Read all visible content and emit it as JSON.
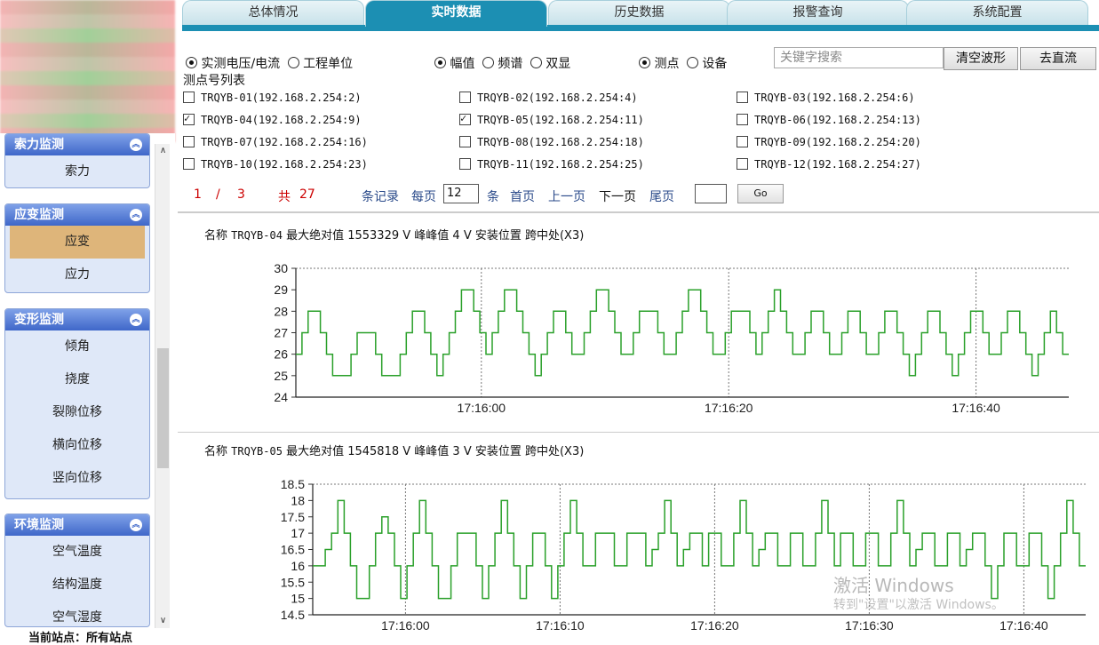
{
  "tabs": [
    "总体情况",
    "实时数据",
    "历史数据",
    "报警查询",
    "系统配置"
  ],
  "active_tab": 1,
  "sidebar": {
    "groups": [
      {
        "title": "索力监测",
        "items": [
          "索力"
        ]
      },
      {
        "title": "应变监测",
        "items": [
          "应变",
          "应力"
        ],
        "active": 0
      },
      {
        "title": "变形监测",
        "items": [
          "倾角",
          "挠度",
          "裂隙位移",
          "横向位移",
          "竖向位移"
        ]
      },
      {
        "title": "环境监测",
        "items": [
          "空气温度",
          "结构温度",
          "空气湿度"
        ]
      }
    ],
    "site_label": "当前站点：所有站点"
  },
  "controls": {
    "mode_radios": [
      "实测电压/电流",
      "工程单位"
    ],
    "view_radios": [
      "幅值",
      "频谱",
      "双显"
    ],
    "scope_radios": [
      "测点",
      "设备"
    ],
    "search_placeholder": "关键字搜索",
    "clear_button": "清空波形",
    "dc_button": "去直流"
  },
  "list_title": "测点号列表",
  "points": [
    {
      "label": "TRQYB-01(192.168.2.254:2)",
      "checked": false
    },
    {
      "label": "TRQYB-02(192.168.2.254:4)",
      "checked": false
    },
    {
      "label": "TRQYB-03(192.168.2.254:6)",
      "checked": false
    },
    {
      "label": "TRQYB-04(192.168.2.254:9)",
      "checked": true
    },
    {
      "label": "TRQYB-05(192.168.2.254:11)",
      "checked": true
    },
    {
      "label": "TRQYB-06(192.168.2.254:13)",
      "checked": false
    },
    {
      "label": "TRQYB-07(192.168.2.254:16)",
      "checked": false
    },
    {
      "label": "TRQYB-08(192.168.2.254:18)",
      "checked": false
    },
    {
      "label": "TRQYB-09(192.168.2.254:20)",
      "checked": false
    },
    {
      "label": "TRQYB-10(192.168.2.254:23)",
      "checked": false
    },
    {
      "label": "TRQYB-11(192.168.2.254:25)",
      "checked": false
    },
    {
      "label": "TRQYB-12(192.168.2.254:27)",
      "checked": false
    }
  ],
  "pager": {
    "current": "1",
    "sep": "/",
    "total_pages": "3",
    "total_prefix": "共",
    "total_records": "27",
    "records_label": "条记录",
    "per_page_label": "每页",
    "per_page": "12",
    "unit": "条",
    "first": "首页",
    "prev": "上一页",
    "next": "下一页",
    "last": "尾页",
    "go": "Go"
  },
  "chart_data": [
    {
      "type": "line",
      "title_prefix": "名称",
      "name": "TRQYB-04",
      "stats": "最大绝对值 1553329 V 峰峰值 4 V 安装位置 跨中处(X3)",
      "ylim": [
        24,
        30
      ],
      "yticks": [
        24,
        25,
        26,
        27,
        28,
        29,
        30
      ],
      "xticks": [
        "17:16:00",
        "17:16:20",
        "17:16:40"
      ],
      "color": "#2aa02a",
      "series": [
        {
          "values": [
            26,
            27,
            28,
            28,
            27,
            26,
            25,
            25,
            25,
            26,
            27,
            27,
            27,
            26,
            25,
            25,
            25,
            26,
            27,
            28,
            28,
            27,
            26,
            25,
            26,
            27,
            28,
            29,
            29,
            28,
            27,
            26,
            27,
            28,
            29,
            29,
            28,
            27,
            26,
            25,
            26,
            27,
            28,
            28,
            27,
            26,
            26,
            27,
            28,
            29,
            29,
            28,
            27,
            26,
            26,
            27,
            28,
            28,
            28,
            27,
            26,
            26,
            27,
            28,
            29,
            29,
            28,
            27,
            26,
            26,
            27,
            28,
            28,
            28,
            27,
            26,
            27,
            28,
            29,
            28,
            27,
            26,
            26,
            27,
            28,
            28,
            27,
            26,
            26,
            27,
            28,
            28,
            27,
            26,
            26,
            27,
            28,
            28,
            27,
            26,
            25,
            26,
            27,
            28,
            28,
            27,
            26,
            25,
            26,
            27,
            28,
            28,
            27,
            26,
            26,
            27,
            28,
            28,
            27,
            26,
            25,
            26,
            27,
            28,
            27,
            26
          ]
        }
      ]
    },
    {
      "type": "line",
      "title_prefix": "名称",
      "name": "TRQYB-05",
      "stats": "最大绝对值 1545818 V 峰峰值 3 V 安装位置 跨中处(X3)",
      "ylim": [
        14.5,
        18.5
      ],
      "yticks": [
        14.5,
        15,
        15.5,
        16,
        16.5,
        17,
        17.5,
        18,
        18.5
      ],
      "xticks": [
        "17:16:00",
        "17:16:10",
        "17:16:20",
        "17:16:30",
        "17:16:40"
      ],
      "color": "#2aa02a",
      "series": [
        {
          "values": [
            16,
            16,
            16.5,
            17,
            18,
            17,
            16,
            15,
            15,
            16,
            17,
            17.5,
            17,
            16,
            15,
            16,
            17,
            18,
            17,
            16,
            15,
            15,
            16,
            17,
            17,
            17,
            16,
            15,
            16,
            17,
            18,
            17,
            16,
            15,
            16,
            17,
            17,
            16,
            15,
            16,
            17,
            18,
            17,
            16,
            16,
            17,
            17,
            17,
            16,
            16,
            17,
            17,
            17,
            16,
            16.5,
            17,
            18,
            17,
            16,
            16.5,
            17,
            17,
            16,
            17,
            17,
            16,
            16,
            17,
            18,
            17,
            16,
            16.5,
            17,
            17,
            16,
            16,
            17,
            17,
            16,
            16,
            17,
            18,
            17,
            16,
            17,
            17,
            16,
            16,
            17,
            17,
            16,
            16,
            17,
            18,
            17,
            16,
            16.5,
            17,
            17,
            16,
            16,
            17,
            17,
            16,
            16.5,
            17,
            17,
            16,
            15,
            16,
            17,
            17,
            16,
            16,
            17,
            17,
            16,
            15,
            16,
            17,
            18,
            17,
            16
          ]
        }
      ]
    }
  ],
  "watermark": {
    "line1": "激活 Windows",
    "line2": "转到\"设置\"以激活 Windows。"
  }
}
